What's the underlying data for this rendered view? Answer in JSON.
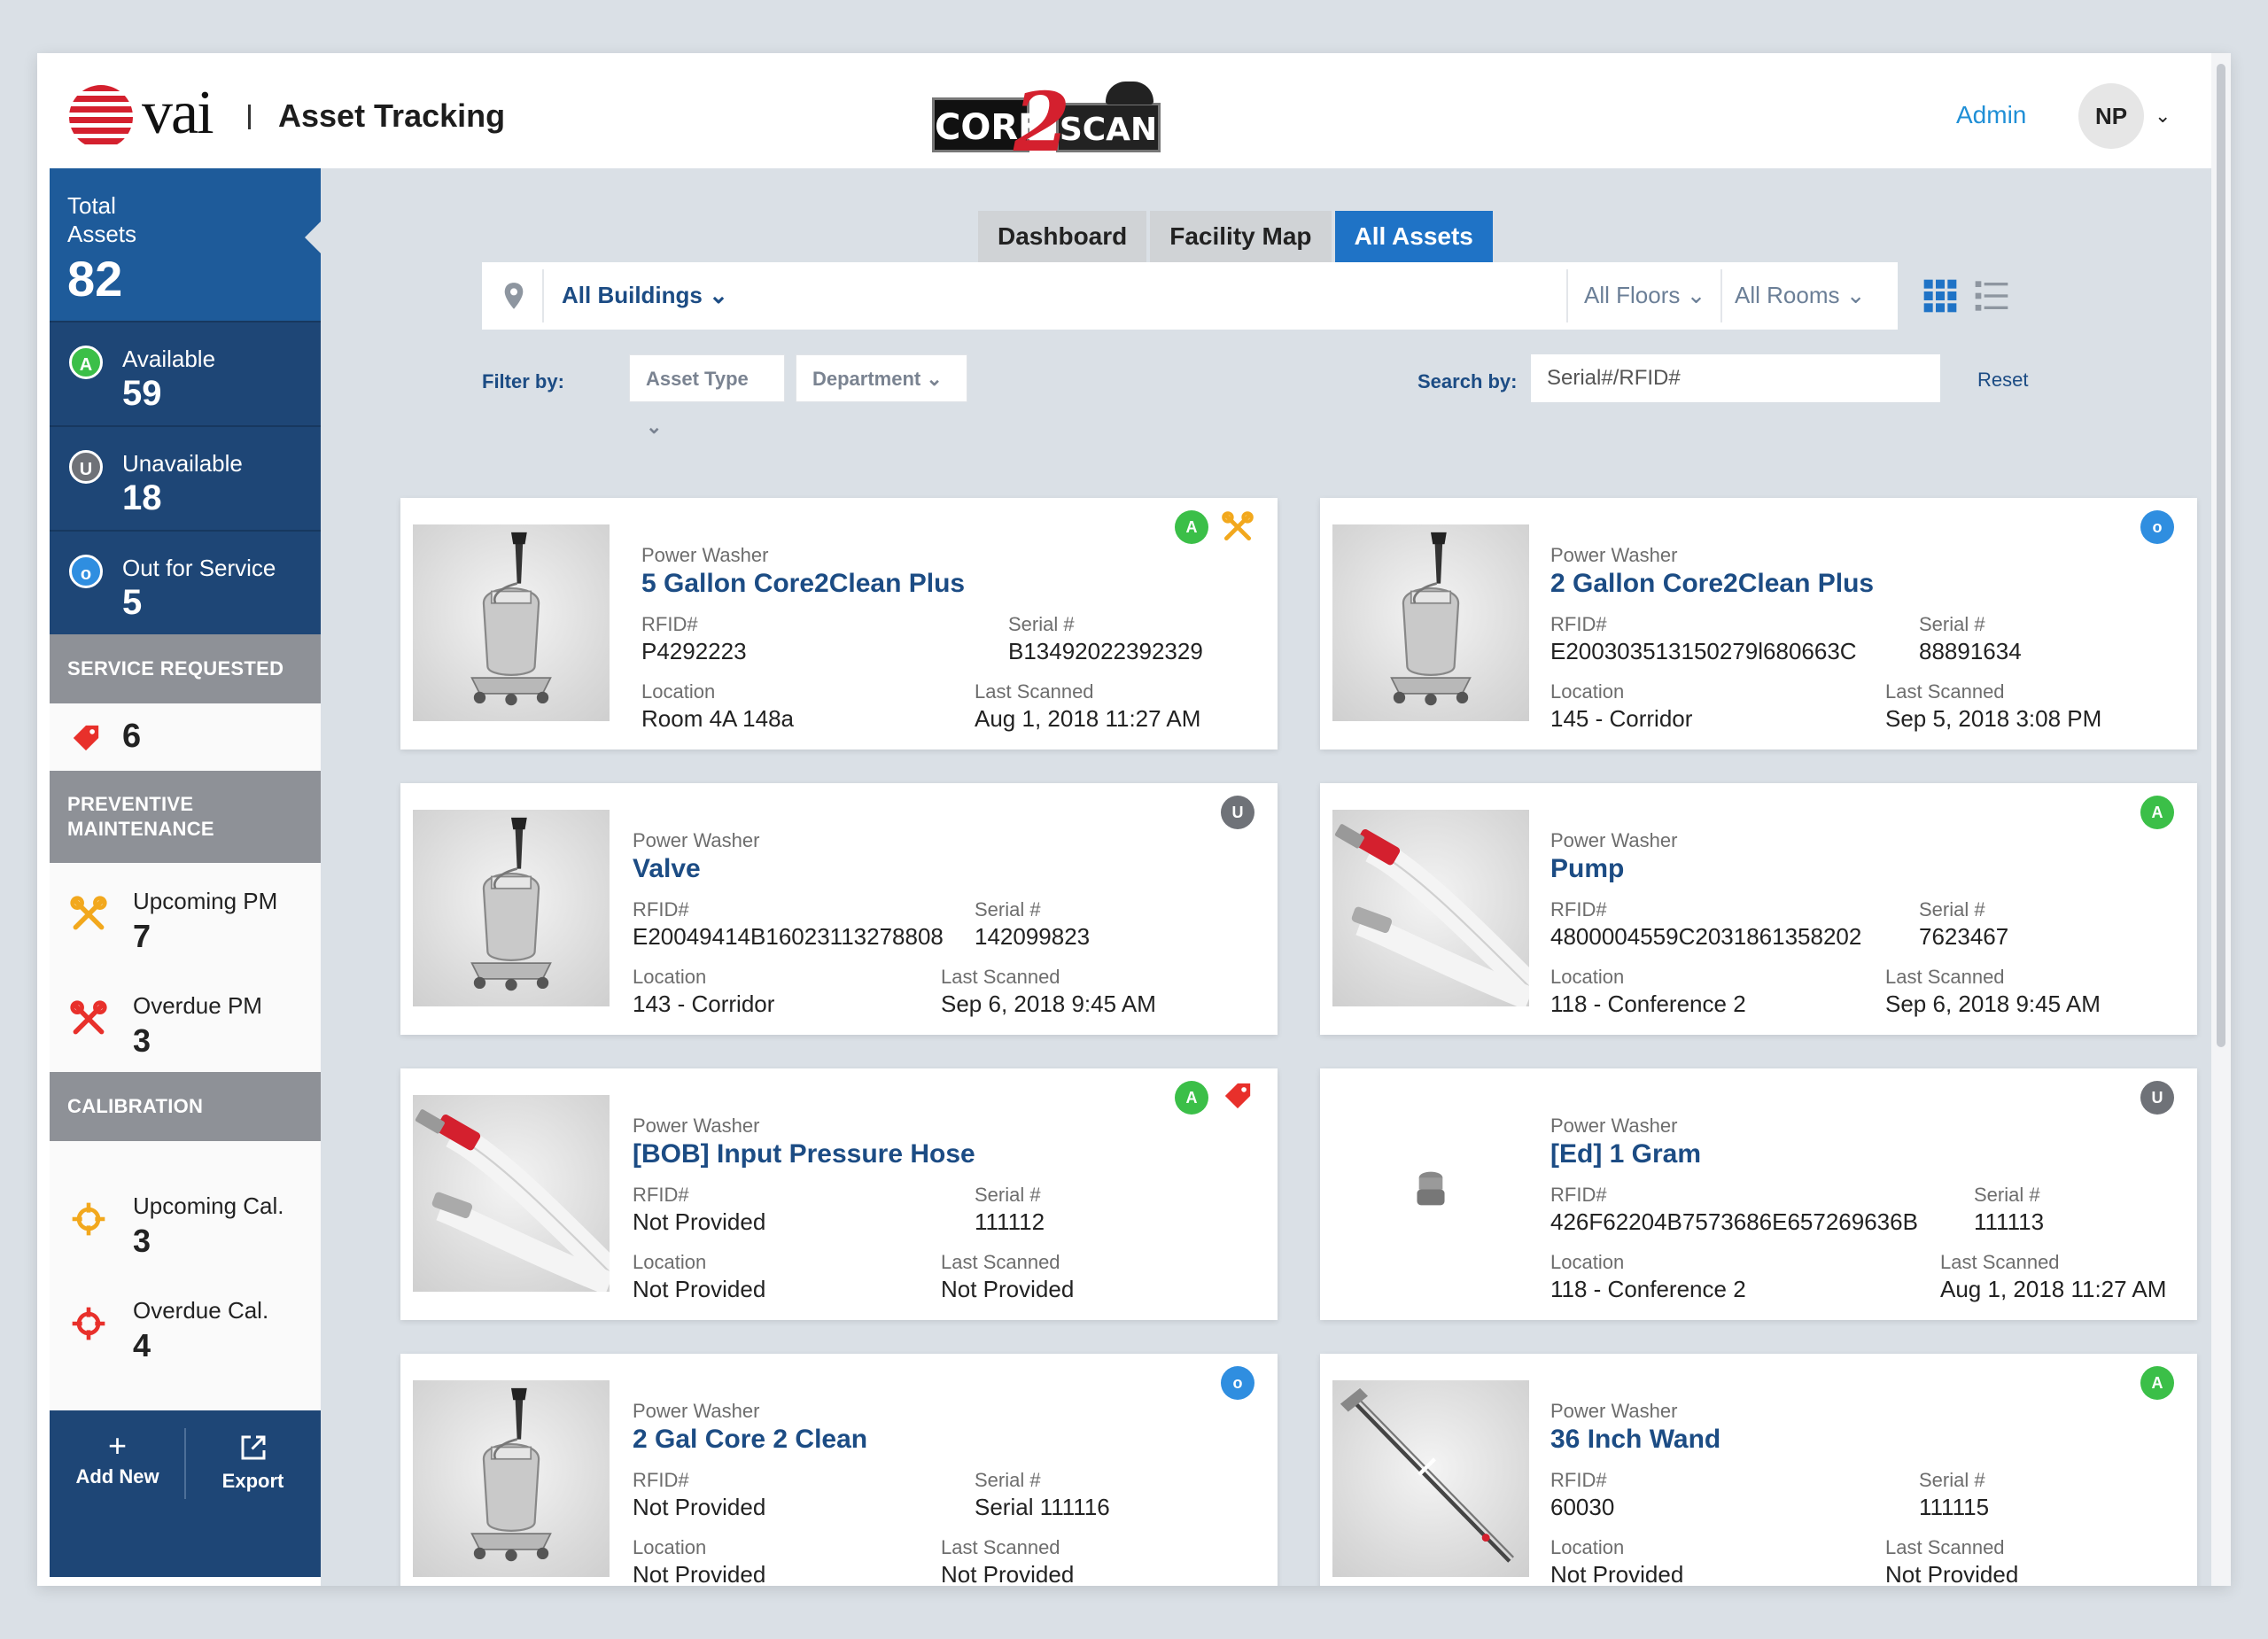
{
  "header": {
    "brand": "vai",
    "app_title": "Asset Tracking",
    "product_core": "CORE",
    "product_two": "2",
    "product_scan": "SCAN",
    "admin_link": "Admin",
    "avatar_initials": "NP"
  },
  "sidebar": {
    "total_label": "Total Assets",
    "total_value": "82",
    "available": {
      "badge": "A",
      "label": "Available",
      "value": "59",
      "color": "#3bbf48"
    },
    "unavailable": {
      "badge": "U",
      "label": "Unavailable",
      "value": "18",
      "color": "#6f7278"
    },
    "out_for_service": {
      "badge": "o",
      "label": "Out for Service",
      "value": "5",
      "color": "#2f8ee0"
    },
    "service_requested_title": "SERVICE REQUESTED",
    "service_requested_value": "6",
    "pm_title": "PREVENTIVE MAINTENANCE",
    "upcoming_pm": {
      "label": "Upcoming PM",
      "value": "7",
      "icon": "wrench-icon",
      "color": "#f2a81d"
    },
    "overdue_pm": {
      "label": "Overdue PM",
      "value": "3",
      "icon": "wrench-icon",
      "color": "#e8302b"
    },
    "calibration_title": "CALIBRATION",
    "upcoming_cal": {
      "label": "Upcoming Cal.",
      "value": "3",
      "icon": "crosshair-icon",
      "color": "#f2a81d"
    },
    "overdue_cal": {
      "label": "Overdue Cal.",
      "value": "4",
      "icon": "crosshair-icon",
      "color": "#e8302b"
    },
    "add_new_label": "Add New",
    "export_label": "Export"
  },
  "tabs": [
    {
      "label": "Dashboard",
      "active": false
    },
    {
      "label": "Facility Map",
      "active": false
    },
    {
      "label": "All Assets",
      "active": true
    }
  ],
  "filters": {
    "building": "All Buildings",
    "floors": "All Floors",
    "rooms": "All Rooms",
    "filter_by_label": "Filter by:",
    "asset_type": "Asset Type",
    "department": "Department",
    "search_by_label": "Search by:",
    "search_placeholder": "Serial#/RFID#",
    "reset_label": "Reset"
  },
  "card_labels": {
    "rfid": "RFID#",
    "serial": "Serial #",
    "location": "Location",
    "last_scanned": "Last Scanned"
  },
  "assets": [
    {
      "type": "Power Washer",
      "name": "5 Gallon Core2Clean Plus",
      "rfid": "P4292223",
      "serial": "B13492022392329",
      "location": "Room 4A 148a",
      "last_scanned": "Aug 1, 2018 11:27 AM",
      "status": "A",
      "flag": "wrench-icon",
      "image": "power-washer-tank"
    },
    {
      "type": "Power Washer",
      "name": "2 Gallon Core2Clean Plus",
      "rfid": "E200303513150279l680663C",
      "serial": "88891634",
      "location": "145 - Corridor",
      "last_scanned": "Sep 5, 2018 3:08 PM",
      "status": "o",
      "image": "power-washer-tank"
    },
    {
      "type": "Power Washer",
      "name": "Valve",
      "rfid": "E20049414B16023113278808",
      "serial": "142099823",
      "location": "143 - Corridor",
      "last_scanned": "Sep 6, 2018 9:45 AM",
      "status": "U",
      "image": "power-washer-tank"
    },
    {
      "type": "Power Washer",
      "name": "Pump",
      "rfid": "4800004559C2031861358202",
      "serial": "7623467",
      "location": "118 - Conference 2",
      "last_scanned": "Sep 6, 2018 9:45 AM",
      "status": "A",
      "image": "hose"
    },
    {
      "type": "Power Washer",
      "name": "[BOB] Input Pressure Hose",
      "rfid": "Not Provided",
      "serial": "111112",
      "location": "Not Provided",
      "last_scanned": "Not Provided",
      "status": "A",
      "flag": "tag-icon",
      "image": "hose"
    },
    {
      "type": "Power Washer",
      "name": "[Ed] 1 Gram",
      "rfid": "426F62204B7573686E657269636B",
      "serial": "111113",
      "location": "118 - Conference 2",
      "last_scanned": "Aug 1, 2018 11:27 AM",
      "status": "U",
      "image": "weight"
    },
    {
      "type": "Power Washer",
      "name": "2 Gal Core 2 Clean",
      "rfid": "Not Provided",
      "serial": "Serial 111116",
      "location": "Not Provided",
      "last_scanned": "Not Provided",
      "status": "o",
      "image": "power-washer-tank"
    },
    {
      "type": "Power Washer",
      "name": "36 Inch Wand",
      "rfid": "60030",
      "serial": "111115",
      "location": "Not Provided",
      "last_scanned": "Not Provided",
      "status": "A",
      "image": "wand"
    }
  ]
}
